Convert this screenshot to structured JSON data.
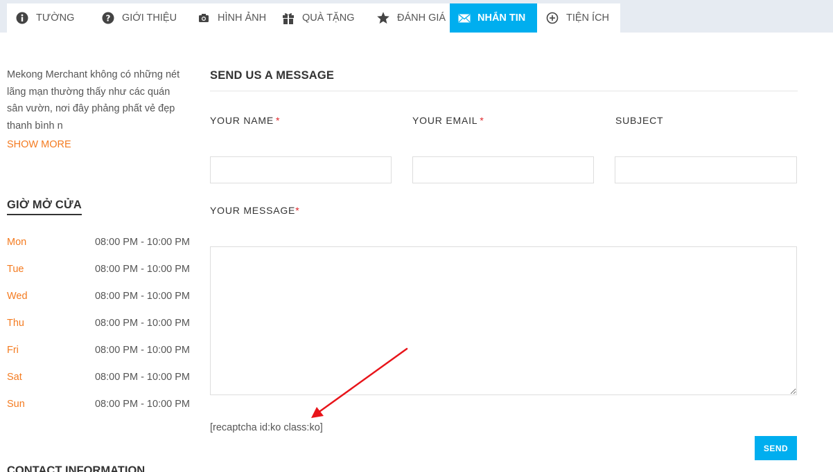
{
  "tabs": [
    {
      "label": "TƯỜNG",
      "icon": "info-icon"
    },
    {
      "label": "GIỚI THIỆU",
      "icon": "question-icon"
    },
    {
      "label": "HÌNH ẢNH",
      "icon": "camera-icon"
    },
    {
      "label": "QUÀ TẶNG",
      "icon": "gift-icon"
    },
    {
      "label": "ĐÁNH GIÁ",
      "icon": "star-icon"
    },
    {
      "label": "NHẮN TIN",
      "icon": "envelope-icon",
      "active": true
    },
    {
      "label": "TIỆN ÍCH",
      "icon": "plus-circle-icon"
    }
  ],
  "sidebar": {
    "about_text": "Mekong Merchant không có những nét lãng mạn thường thấy như các quán sân vườn, nơi đây phảng phất vẻ đẹp thanh bình n",
    "show_more": "SHOW MORE",
    "hours_title": "GIỜ MỞ CỬA",
    "hours": [
      {
        "day": "Mon",
        "time": "08:00 PM - 10:00 PM"
      },
      {
        "day": "Tue",
        "time": "08:00 PM - 10:00 PM"
      },
      {
        "day": "Wed",
        "time": "08:00 PM - 10:00 PM"
      },
      {
        "day": "Thu",
        "time": "08:00 PM - 10:00 PM"
      },
      {
        "day": "Fri",
        "time": "08:00 PM - 10:00 PM"
      },
      {
        "day": "Sat",
        "time": "08:00 PM - 10:00 PM"
      },
      {
        "day": "Sun",
        "time": "08:00 PM - 10:00 PM"
      }
    ],
    "contact_title": "CONTACT INFORMATION"
  },
  "form": {
    "title": "SEND US A MESSAGE",
    "name_label": "YOUR NAME",
    "email_label": "YOUR EMAIL",
    "subject_label": "SUBJECT",
    "message_label": "YOUR MESSAGE",
    "required_mark": "*",
    "name_value": "",
    "email_value": "",
    "subject_value": "",
    "message_value": "",
    "recaptcha_text": "[recaptcha id:ko class:ko]",
    "send_label": "SEND"
  },
  "colors": {
    "accent": "#00aeef",
    "link": "#f47b20",
    "required": "#e0262a",
    "annotation_arrow": "#e8141a"
  }
}
